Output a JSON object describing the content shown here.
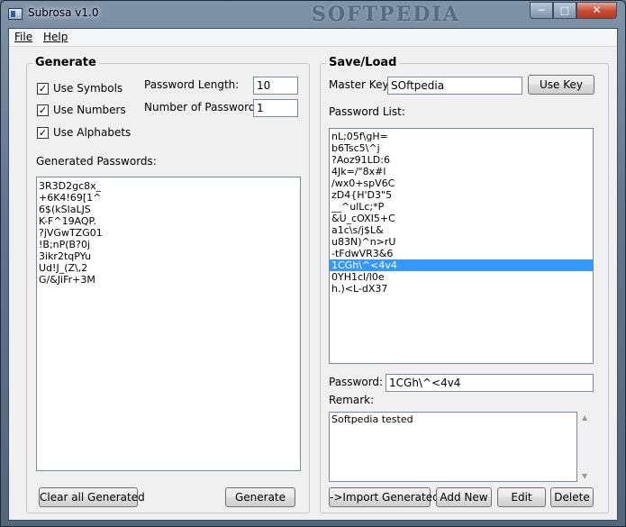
{
  "window": {
    "title": "Subrosa v1.0",
    "watermark": "SOFTPEDIA"
  },
  "menu": {
    "file": "File",
    "help": "Help"
  },
  "generate": {
    "title": "Generate",
    "use_symbols": "Use Symbols",
    "use_numbers": "Use Numbers",
    "use_alphabets": "Use Alphabets",
    "password_length_label": "Password Length:",
    "password_length_value": "10",
    "num_passwords_label": "Number of Passwords:",
    "num_passwords_value": "1",
    "generated_label": "Generated Passwords:",
    "generated": [
      "3R3D2gc8x_",
      "+6K4!69[1^",
      "6$(kSlaLJS",
      "K-F^19AQP.",
      "?jVGwTZG01",
      "!B;nP(B?0j",
      "3ikr2tqPYu",
      "Ud!J_(Z\\,2",
      "G/&JiFr+3M"
    ],
    "clear_button": "Clear all Generated",
    "generate_button": "Generate"
  },
  "saveload": {
    "title": "Save/Load",
    "master_key_label": "Master Key:",
    "master_key_value": "SOftpedia",
    "use_key_button": "Use Key",
    "list_label": "Password List:",
    "list": [
      "nL;05f\\gH=",
      "b6Tsc5\\^j",
      "?Aoz91LD:6",
      "4Jk=/\"8x#l",
      "/wx0+spV6C",
      "zD4{H'D3\"5",
      "__^ulLc;*P",
      "&U_cOXI5+C",
      "a1c\\s/j$L&",
      "u83N)^n>rU",
      "-tFdwVR3&6",
      "1CGh\\^<4v4",
      "0YH1cl/l0e",
      "h.)<L-dX37"
    ],
    "selected_index": 11,
    "password_label": "Password:",
    "password_value": "1CGh\\^<4v4",
    "remark_label": "Remark:",
    "remark_value": "Softpedia tested",
    "import_button": "->Import Generated",
    "add_button": "Add New",
    "edit_button": "Edit",
    "delete_button": "Delete"
  },
  "icons": [
    "app-icon",
    "minimize-icon",
    "maximize-icon",
    "close-icon",
    "check-icon",
    "scroll-up-icon",
    "scroll-down-icon"
  ]
}
